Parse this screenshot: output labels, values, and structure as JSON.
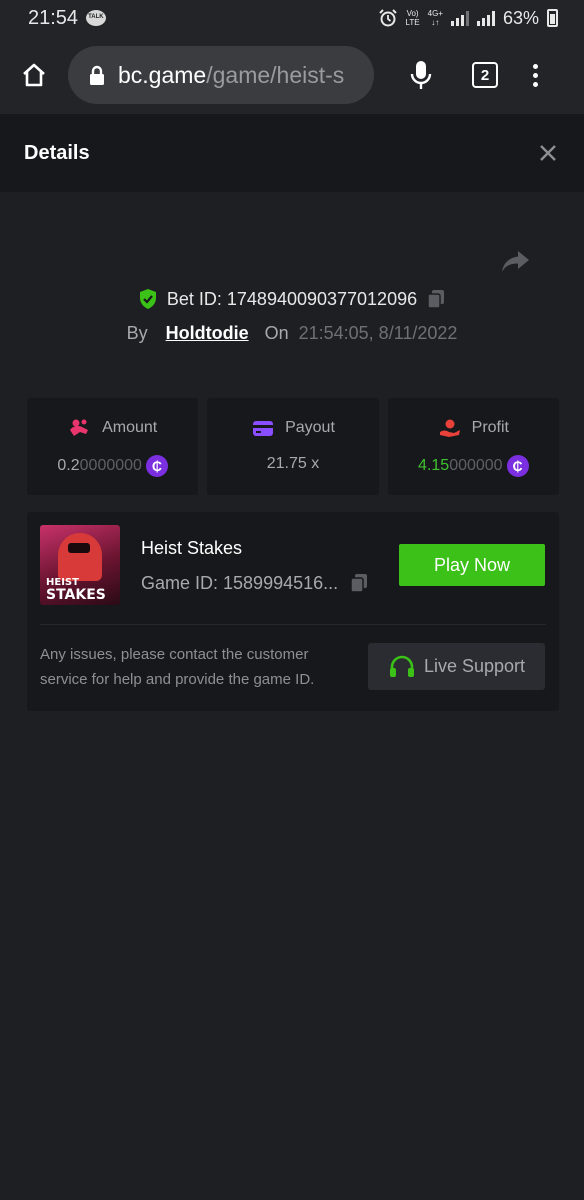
{
  "status_bar": {
    "time": "21:54",
    "battery": "63%",
    "network_top": "Vo)",
    "network_bottom": "LTE",
    "net_gen": "4G+"
  },
  "browser": {
    "url_host": "bc.game",
    "url_path": "/game/heist-s",
    "tab_count": "2"
  },
  "details": {
    "title": "Details"
  },
  "bet": {
    "bet_id_label": "Bet ID: 1748940090377012096",
    "by_label": "By",
    "username": "Holdtodie",
    "on_label": "On",
    "datetime": "21:54:05, 8/11/2022"
  },
  "stats": {
    "amount": {
      "label": "Amount",
      "value_strong": "0.2",
      "value_dim": "0000000"
    },
    "payout": {
      "label": "Payout",
      "value": "21.75 x"
    },
    "profit": {
      "label": "Profit",
      "value_strong": "4.15",
      "value_dim": "000000"
    }
  },
  "game": {
    "name": "Heist Stakes",
    "thumb_line1": "HEIST",
    "thumb_line2": "STAKES",
    "game_id": "Game ID: 1589994516...",
    "play_label": "Play Now",
    "help_text": "Any issues, please contact the customer service for help and provide the game ID.",
    "support_label": "Live Support"
  },
  "colors": {
    "accent_green": "#3bc117",
    "coin_purple": "#7b2fe0",
    "amount_pink": "#e8356d",
    "payout_purple": "#8a4dff",
    "profit_red": "#e8413a"
  }
}
